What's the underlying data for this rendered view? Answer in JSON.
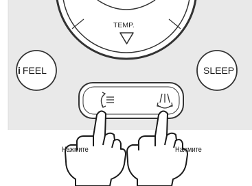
{
  "remote": {
    "temp_label": "TEMP.",
    "ifeel_button": {
      "icon_text": "i",
      "label": "FEEL"
    },
    "sleep_button": {
      "label": "SLEEP"
    },
    "vertical_swing_icon": "vertical-swing-icon",
    "horizontal_swing_icon": "horizontal-swing-icon"
  },
  "hands": {
    "left_label": "Нажмите",
    "right_label": "Нажмите"
  },
  "colors": {
    "panel": "#e9e9e9",
    "outline": "#333333",
    "hand_fill": "#ffffff"
  }
}
